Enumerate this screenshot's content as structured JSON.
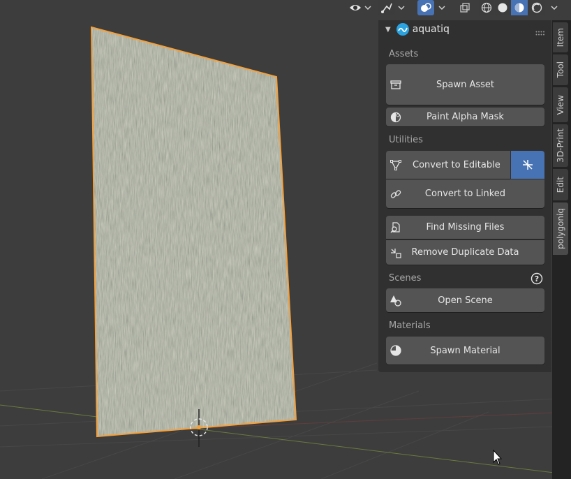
{
  "panel": {
    "title": "aquatiq",
    "sections": {
      "assets": "Assets",
      "utilities": "Utilities",
      "scenes": "Scenes",
      "materials": "Materials"
    },
    "buttons": {
      "spawn_asset": "Spawn Asset",
      "paint_alpha_mask": "Paint Alpha Mask",
      "convert_to_editable": "Convert to Editable",
      "convert_to_linked": "Convert to Linked",
      "find_missing_files": "Find Missing Files",
      "remove_duplicate_data": "Remove Duplicate Data",
      "open_scene": "Open Scene",
      "spawn_material": "Spawn Material"
    }
  },
  "tabs": [
    "Item",
    "Tool",
    "View",
    "3D-Print",
    "Edit",
    "polygoniq"
  ],
  "active_tab": "polygoniq",
  "icons": {
    "header": [
      "eye-icon",
      "gizmo-icon",
      "overlay-icon",
      "xray-icon",
      "wireframe-shading-icon",
      "solid-shading-icon",
      "material-shading-icon",
      "rendered-shading-icon"
    ],
    "panel": [
      "aquatiq-logo-icon",
      "drag-handle-icon",
      "box-icon",
      "paint-mask-icon",
      "vertex-icon",
      "merge-icon",
      "link-icon",
      "find-files-icon",
      "remove-duplicates-icon",
      "help-icon",
      "scene-icon",
      "material-icon"
    ]
  },
  "colors": {
    "viewport_bg": "#3d3d3d",
    "panel_bg": "#303030",
    "button_bg": "#545454",
    "accent_blue": "#4772b3",
    "selection_orange": "#f5a03a"
  }
}
